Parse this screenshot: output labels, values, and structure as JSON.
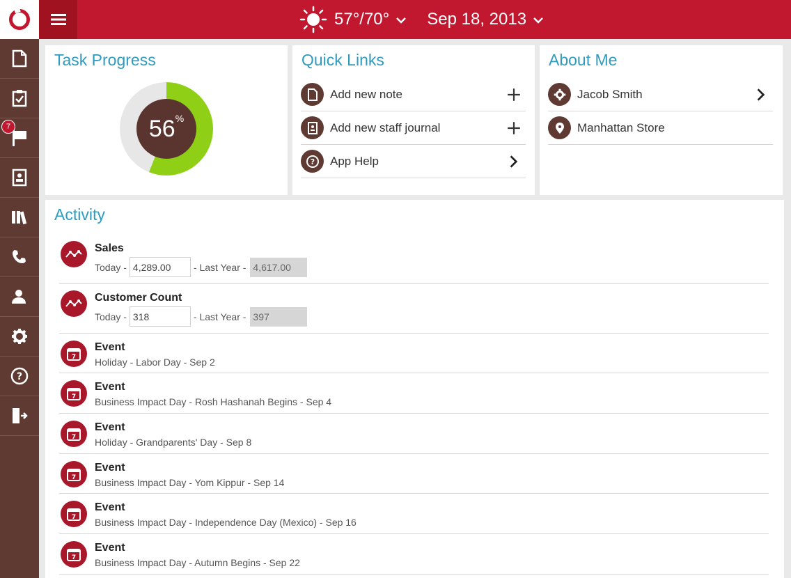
{
  "header": {
    "weather": {
      "icon": "sun-icon",
      "temp": "57°/70°"
    },
    "date": "Sep 18, 2013"
  },
  "sidebar": {
    "items": [
      {
        "icon": "document-icon"
      },
      {
        "icon": "clipboard-check-icon"
      },
      {
        "icon": "flag-icon",
        "badge": "7"
      },
      {
        "icon": "contact-card-icon"
      },
      {
        "icon": "books-icon"
      },
      {
        "icon": "phone-icon"
      },
      {
        "icon": "user-icon"
      },
      {
        "icon": "gear-icon"
      },
      {
        "icon": "help-icon"
      },
      {
        "icon": "logout-icon"
      }
    ]
  },
  "task_progress": {
    "title": "Task Progress",
    "value": "56",
    "unit": "%",
    "fraction": 0.56,
    "colors": {
      "fill": "#8fd016",
      "track": "#e7e7e7",
      "center": "#5a3530"
    }
  },
  "quick_links": {
    "title": "Quick Links",
    "items": [
      {
        "label": "Add new note",
        "icon": "note-icon",
        "action": "plus-icon"
      },
      {
        "label": "Add new staff journal",
        "icon": "journal-icon",
        "action": "plus-icon"
      },
      {
        "label": "App Help",
        "icon": "help-icon",
        "action": "chevron-right-icon"
      }
    ]
  },
  "about_me": {
    "title": "About Me",
    "items": [
      {
        "label": "Jacob Smith",
        "icon": "gear-icon",
        "action": "chevron-right-icon"
      },
      {
        "label": "Manhattan Store",
        "icon": "location-pin-icon"
      }
    ]
  },
  "activity": {
    "title": "Activity",
    "metrics": [
      {
        "title": "Sales",
        "today_label": "Today -",
        "today": "4,289.00",
        "last_year_label": "- Last Year -",
        "last_year": "4,617.00"
      },
      {
        "title": "Customer Count",
        "today_label": "Today -",
        "today": "318",
        "last_year_label": "- Last Year -",
        "last_year": "397"
      }
    ],
    "events": [
      {
        "title": "Event",
        "detail": "Holiday - Labor Day - Sep 2"
      },
      {
        "title": "Event",
        "detail": "Business Impact Day - Rosh Hashanah Begins - Sep 4"
      },
      {
        "title": "Event",
        "detail": "Holiday - Grandparents' Day - Sep 8"
      },
      {
        "title": "Event",
        "detail": "Business Impact Day - Yom Kippur - Sep 14"
      },
      {
        "title": "Event",
        "detail": "Business Impact Day - Independence Day (Mexico) - Sep 16"
      },
      {
        "title": "Event",
        "detail": "Business Impact Day - Autumn Begins - Sep 22"
      }
    ],
    "calendar_day": "7"
  },
  "colors": {
    "brand_red": "#c2182f",
    "sidebar_brown": "#5e3a33",
    "title_blue": "#2f9bbf"
  }
}
